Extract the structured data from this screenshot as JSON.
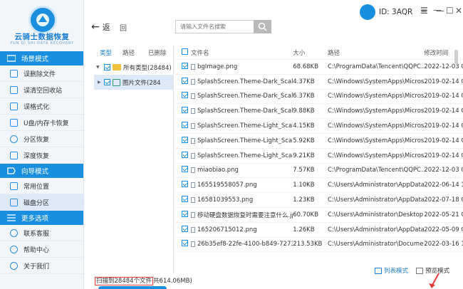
{
  "app": {
    "name": "云骑士数据恢复",
    "subtitle": "YUN QI SHI DATA RECOVERY",
    "user_id": "ID: 3AQR"
  },
  "sidebar": {
    "sections": [
      {
        "title": "场景模式",
        "items": [
          {
            "label": "误删除文件"
          },
          {
            "label": "误清空回收站"
          },
          {
            "label": "误格式化"
          },
          {
            "label": "U盘/内存卡恢复"
          },
          {
            "label": "分区恢复"
          },
          {
            "label": "深度恢复"
          }
        ]
      },
      {
        "title": "向导模式",
        "items": [
          {
            "label": "常用位置"
          },
          {
            "label": "磁盘分区"
          }
        ]
      },
      {
        "title": "更多选项",
        "items": [
          {
            "label": "联系客服"
          },
          {
            "label": "帮助中心"
          },
          {
            "label": "关于我们"
          }
        ]
      }
    ]
  },
  "toolbar": {
    "back_label": "返",
    "forward_label": "回",
    "search_placeholder": "请输入文件名搜索"
  },
  "tree": {
    "tabs": [
      "类型",
      "路径",
      "已删除"
    ],
    "nodes": [
      {
        "label": "所有类型(28484)"
      },
      {
        "label": "图片文件(284"
      }
    ]
  },
  "table": {
    "headers": [
      "文件名",
      "大小",
      "路径",
      "修改时间"
    ],
    "rows": [
      {
        "name": "bgImage.png",
        "size": "68.68KB",
        "path": "C:\\ProgramData\\Tencent\\QQPC...",
        "date": "2022-12-03 0"
      },
      {
        "name": "SplashScreen.Theme-Dark_Scale-1...",
        "size": "4.37KB",
        "path": "C:\\Windows\\SystemApps\\Micros...",
        "date": "2019-02-14 C"
      },
      {
        "name": "SplashScreen.Theme-Dark_Scale-1...",
        "size": "6.37KB",
        "path": "C:\\Windows\\SystemApps\\Micros...",
        "date": "2019-02-14 C"
      },
      {
        "name": "SplashScreen.Theme-Dark_Scale-1...",
        "size": "9.88KB",
        "path": "C:\\Windows\\SystemApps\\Micros...",
        "date": "2019-02-14 C"
      },
      {
        "name": "SplashScreen.Theme-Light_Scale-1...",
        "size": "4.15KB",
        "path": "C:\\Windows\\SystemApps\\Micros...",
        "date": "2019-02-14 C"
      },
      {
        "name": "SplashScreen.Theme-Light_Scale-1...",
        "size": "5.92KB",
        "path": "C:\\Windows\\SystemApps\\Micros...",
        "date": "2019-02-14 C"
      },
      {
        "name": "SplashScreen.Theme-Light_Scale-1...",
        "size": "9.21KB",
        "path": "C:\\Windows\\SystemApps\\Micros...",
        "date": "2019-02-14 C"
      },
      {
        "name": "miaobiao.png",
        "size": "7.57KB",
        "path": "C:\\ProgramData\\Tencent\\QQPC...",
        "date": "2022-12-03 0"
      },
      {
        "name": "165519558057.png",
        "size": "1.10KB",
        "path": "C:\\Users\\Administrator\\AppData...",
        "date": "2022-06-14 1"
      },
      {
        "name": "16581039553.png",
        "size": "1.23KB",
        "path": "C:\\Users\\Administrator\\AppData...",
        "date": "2022-07-18 C"
      },
      {
        "name": "移动硬盘数据恢复时需要注意什么.jpg",
        "size": "60.70KB",
        "path": "C:\\Users\\Administrator\\Desktop...",
        "date": "2022-05-21 C"
      },
      {
        "name": "165206715012.png",
        "size": "1.26KB",
        "path": "C:\\Users\\Administrator\\AppData...",
        "date": "2022-05-09 C"
      },
      {
        "name": "26b35ef8-22fe-4100-b849-7273d5...",
        "size": "213.53KB",
        "path": "C:\\Users\\Administrator\\Docume...",
        "date": "2022-03-16 1"
      },
      {
        "name": "",
        "size": "",
        "path": "",
        "date": ""
      }
    ]
  },
  "status": {
    "text_highlight": "扫描到28484个文件",
    "text_rest": "共614.06MB)"
  },
  "views": {
    "list_label": "列表模式",
    "thumb_label": "预览模式"
  },
  "colors": {
    "accent": "#1a8fe0",
    "highlight_border": "#e23b3b"
  }
}
